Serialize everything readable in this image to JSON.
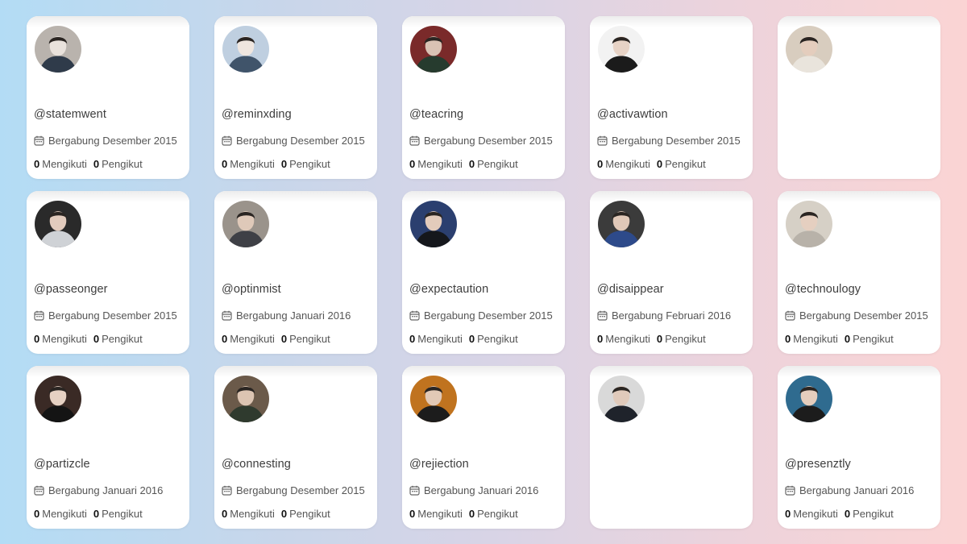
{
  "labels": {
    "following": "Mengikuti",
    "followers": "Pengikut"
  },
  "colors": {
    "background_left": "#b3dcf5",
    "background_right": "#fbd4d4",
    "card": "#ffffff"
  },
  "icons": {
    "calendar": "calendar-icon"
  },
  "profiles": [
    {
      "handle": "@statemwent",
      "joined": "Bergabung Desember 2015",
      "following": "0",
      "followers": "0",
      "avatar": [
        "#b9b3ad",
        "#2f3b4a",
        "#e9e2dc"
      ]
    },
    {
      "handle": "@reminxding",
      "joined": "Bergabung Desember 2015",
      "following": "0",
      "followers": "0",
      "avatar": [
        "#bfcfe0",
        "#40546a",
        "#efe6df"
      ]
    },
    {
      "handle": "@teacring",
      "joined": "Bergabung Desember 2015",
      "following": "0",
      "followers": "0",
      "avatar": [
        "#7a2a2a",
        "#263b2e",
        "#d9c2b4"
      ]
    },
    {
      "handle": "@activawtion",
      "joined": "Bergabung Desember 2015",
      "following": "0",
      "followers": "0",
      "avatar": [
        "#f2f2f2",
        "#1b1b1b",
        "#e7d3c6"
      ]
    },
    {
      "handle": "",
      "joined": "",
      "following": "",
      "followers": "",
      "avatar": [
        "#d8cdbf",
        "#e9e4dc",
        "#e4cdbd"
      ]
    },
    {
      "handle": "@passeonger",
      "joined": "Bergabung Desember 2015",
      "following": "0",
      "followers": "0",
      "avatar": [
        "#2a2a2a",
        "#cfd2d6",
        "#e2cbbd"
      ]
    },
    {
      "handle": "@optinmist",
      "joined": "Bergabung Januari 2016",
      "following": "0",
      "followers": "0",
      "avatar": [
        "#9a938b",
        "#3e4046",
        "#dfc9b9"
      ]
    },
    {
      "handle": "@expectaution",
      "joined": "Bergabung Desember 2015",
      "following": "0",
      "followers": "0",
      "avatar": [
        "#2b3f6f",
        "#15171c",
        "#e3cbbb"
      ]
    },
    {
      "handle": "@disaippear",
      "joined": "Bergabung Februari 2016",
      "following": "0",
      "followers": "0",
      "avatar": [
        "#3b3b3b",
        "#2d4a8a",
        "#e0c8b8"
      ]
    },
    {
      "handle": "@technoulogy",
      "joined": "Bergabung Desember 2015",
      "following": "0",
      "followers": "0",
      "avatar": [
        "#d6d0c6",
        "#b8b2a9",
        "#e5cfc0"
      ]
    },
    {
      "handle": "@partizcle",
      "joined": "Bergabung Januari 2016",
      "following": "0",
      "followers": "0",
      "avatar": [
        "#3a2a25",
        "#141414",
        "#e6d1c3"
      ]
    },
    {
      "handle": "@connesting",
      "joined": "Bergabung Desember 2015",
      "following": "0",
      "followers": "0",
      "avatar": [
        "#6b5a4a",
        "#2f3a2e",
        "#dcc4b2"
      ]
    },
    {
      "handle": "@rejiection",
      "joined": "Bergabung Januari 2016",
      "following": "0",
      "followers": "0",
      "avatar": [
        "#c0731f",
        "#1c1c1c",
        "#e2c9b6"
      ]
    },
    {
      "handle": "",
      "joined": "",
      "following": "",
      "followers": "",
      "avatar": [
        "#d9d9d9",
        "#1f232b",
        "#e0cabb"
      ]
    },
    {
      "handle": "@presenztly",
      "joined": "Bergabung Januari 2016",
      "following": "0",
      "followers": "0",
      "avatar": [
        "#2f6b8f",
        "#1c1c1c",
        "#e4cdbd"
      ]
    }
  ]
}
